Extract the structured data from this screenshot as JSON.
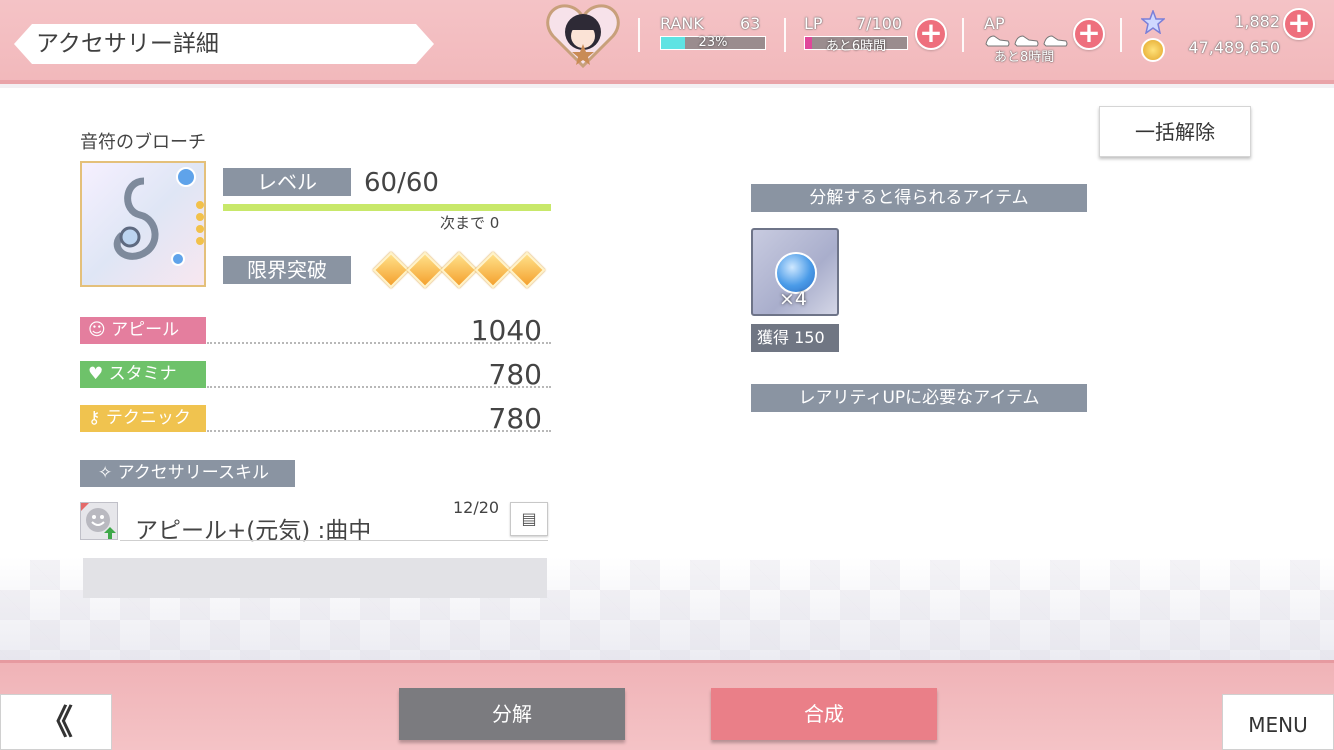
{
  "header": {
    "title": "アクセサリー詳細",
    "rank": {
      "label": "RANK",
      "value": "63",
      "progress_text": "23%",
      "progress": 0.23
    },
    "lp": {
      "label": "LP",
      "value": "7/100",
      "sub": "あと6時間",
      "progress": 0.07
    },
    "ap": {
      "label": "AP",
      "sub": "あと8時間"
    },
    "gems": "1,882",
    "gold": "47,489,650"
  },
  "accessory": {
    "name": "音符のブローチ",
    "level_label": "レベル",
    "level_value": "60/60",
    "next_label": "次まで 0",
    "limit_break_label": "限界突破",
    "limit_break_count": 5
  },
  "stats": [
    {
      "label": "アピール",
      "value": "1040",
      "color": "#e47e9e",
      "icon": "smile-icon"
    },
    {
      "label": "スタミナ",
      "value": "780",
      "color": "#6ec26a",
      "icon": "heart-icon"
    },
    {
      "label": "テクニック",
      "value": "780",
      "color": "#f0c34f",
      "icon": "key-icon"
    }
  ],
  "skill": {
    "section_label": "アクセサリースキル",
    "name": "アピール+(元気) :曲中",
    "count": "12/20"
  },
  "right": {
    "release_all": "一括解除",
    "disassemble_head": "分解すると得られるアイテム",
    "item_qty": "×4",
    "gain_label": "獲得 150",
    "rarity_head": "レアリティUPに必要なアイテム"
  },
  "footer": {
    "back": "《",
    "disassemble": "分解",
    "combine": "合成",
    "menu": "MENU"
  },
  "colors": {
    "header_pink": "#f2b8bb",
    "disassemble_btn": "#7b7b7f",
    "combine_btn": "#ea7f88",
    "section_gray": "#8a94a2"
  }
}
